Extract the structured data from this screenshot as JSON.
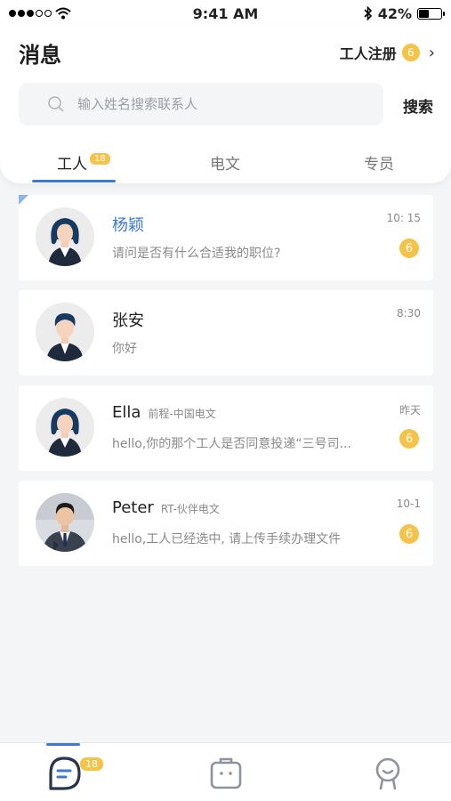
{
  "status_bar": {
    "time": "9:41 AM",
    "battery": "42%",
    "battery_level": 0.42
  },
  "header": {
    "title": "消息",
    "register_label": "工人注册",
    "register_badge": "6"
  },
  "search": {
    "placeholder": "输入姓名搜索联系人",
    "value": "",
    "button_label": "搜索"
  },
  "tabs": [
    {
      "label": "工人",
      "badge": "18",
      "active": true
    },
    {
      "label": "电文",
      "active": false
    },
    {
      "label": "专员",
      "active": false
    }
  ],
  "conversations": [
    {
      "name": "杨颖",
      "company": "",
      "preview": "请问是否有什么合适我的职位?",
      "time": "10: 15",
      "unread": "6",
      "highlighted": true
    },
    {
      "name": "张安",
      "company": "",
      "preview": "你好",
      "time": "8:30",
      "unread": ""
    },
    {
      "name": "Ella",
      "company": "前程-中国电文",
      "preview": "hello,你的那个工人是否同意投递“三号司...",
      "time": "昨天",
      "unread": "6"
    },
    {
      "name": "Peter",
      "company": "RT-伙伴电文",
      "preview": "hello,工人已经选中, 请上传手续办理文件",
      "time": "10-1",
      "unread": "6"
    }
  ],
  "bottom_nav": {
    "messages_badge": "18"
  },
  "colors": {
    "accent": "#3e7ad3",
    "badge": "#f6c349"
  }
}
